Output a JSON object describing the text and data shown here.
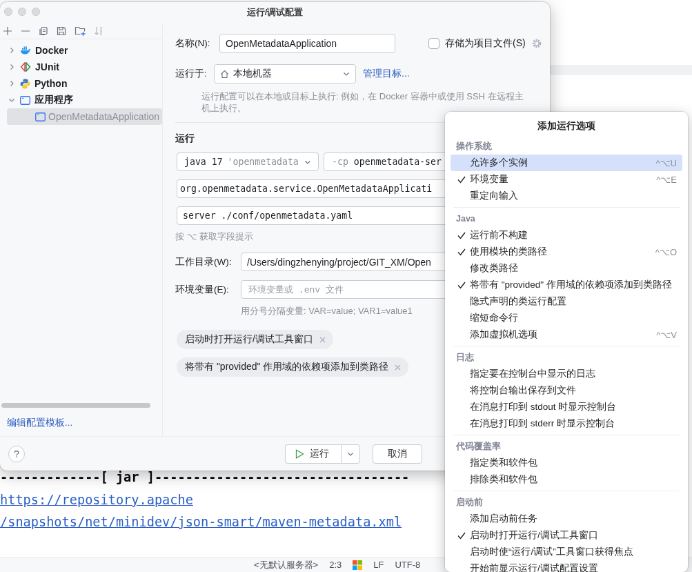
{
  "ide": {
    "console_lines": [
      {
        "kind": "rule",
        "text": "-------------[ jar ]---------------------------------"
      },
      {
        "kind": "link",
        "text": "https://repository.apache"
      },
      {
        "kind": "link",
        "text": "/snapshots/net/minidev/json-smart/maven-metadata.xml"
      }
    ],
    "status_bar": {
      "server": "<无默认服务器>",
      "position": "2:3",
      "line_separator": "LF",
      "encoding": "UTF-8"
    }
  },
  "dialog": {
    "title": "运行/调试配置",
    "tree": [
      {
        "label": "Docker",
        "kind": "docker",
        "expanded": false,
        "selected": false
      },
      {
        "label": "JUnit",
        "kind": "junit",
        "expanded": false,
        "selected": false
      },
      {
        "label": "Python",
        "kind": "python",
        "expanded": false,
        "selected": false
      },
      {
        "label": "应用程序",
        "kind": "application",
        "expanded": true,
        "selected": false,
        "children": [
          {
            "label": "OpenMetadataApplication",
            "kind": "application",
            "selected": true
          }
        ]
      }
    ],
    "edit_templates_link": "编辑配置模板...",
    "form": {
      "name_label": "名称(N):",
      "name_value": "OpenMetadataApplication",
      "store_checkbox": {
        "label": "存储为项目文件(S)",
        "checked": false
      },
      "run_on_label": "运行于:",
      "run_on_value": "本地机器",
      "manage_link": "管理目标...",
      "run_on_hint": "运行配置可以在本地或目标上执行: 例如，在 Docker 容器中或使用 SSH 在远程主机上执行。",
      "section_title": "运行",
      "jdk_version": "java 17",
      "jdk_name": "'openmetadata",
      "cp_flag": "-cp",
      "cp_value": "openmetadata-ser",
      "main_class": "org.openmetadata.service.OpenMetadataApplicati",
      "program_args": "server ./conf/openmetadata.yaml",
      "field_hint": "按 ⌥ 获取字段提示",
      "workdir_label": "工作目录(W):",
      "workdir_value": "/Users/dingzhenying/project/GIT_XM/Open",
      "env_label": "环境变量(E):",
      "env_placeholder": "环境变量或 .env 文件",
      "env_hint": "用分号分隔变量: VAR=value; VAR1=value1",
      "option_tags": [
        "启动时打开运行/调试工具窗口",
        "将带有 \"provided\" 作用域的依赖项添加到类路径"
      ]
    },
    "buttons": {
      "help": "?",
      "run": "运行",
      "cancel": "取消"
    }
  },
  "popup": {
    "title": "添加运行选项",
    "groups": [
      {
        "title": "操作系统",
        "items": [
          {
            "label": "允许多个实例",
            "checked": false,
            "selected": true,
            "shortcut": "^⌥U"
          },
          {
            "label": "环境变量",
            "checked": true,
            "selected": false,
            "shortcut": "^⌥E"
          },
          {
            "label": "重定向输入",
            "checked": false,
            "selected": false
          }
        ]
      },
      {
        "title": "Java",
        "items": [
          {
            "label": "运行前不构建",
            "checked": true,
            "selected": false
          },
          {
            "label": "使用模块的类路径",
            "checked": true,
            "selected": false,
            "shortcut": "^⌥O"
          },
          {
            "label": "修改类路径",
            "checked": false,
            "selected": false
          },
          {
            "label": "将带有 \"provided\" 作用域的依赖项添加到类路径",
            "checked": true,
            "selected": false
          },
          {
            "label": "隐式声明的类运行配置",
            "checked": false,
            "selected": false
          },
          {
            "label": "缩短命令行",
            "checked": false,
            "selected": false
          },
          {
            "label": "添加虚拟机选项",
            "checked": false,
            "selected": false,
            "shortcut": "^⌥V"
          }
        ]
      },
      {
        "title": "日志",
        "items": [
          {
            "label": "指定要在控制台中显示的日志",
            "checked": false,
            "selected": false
          },
          {
            "label": "将控制台输出保存到文件",
            "checked": false,
            "selected": false
          },
          {
            "label": "在消息打印到 stdout 时显示控制台",
            "checked": false,
            "selected": false
          },
          {
            "label": "在消息打印到 stderr 时显示控制台",
            "checked": false,
            "selected": false
          }
        ]
      },
      {
        "title": "代码覆盖率",
        "items": [
          {
            "label": "指定类和软件包",
            "checked": false,
            "selected": false
          },
          {
            "label": "排除类和软件包",
            "checked": false,
            "selected": false
          }
        ]
      },
      {
        "title": "启动前",
        "items": [
          {
            "label": "添加启动前任务",
            "checked": false,
            "selected": false
          },
          {
            "label": "启动时打开运行/调试工具窗口",
            "checked": true,
            "selected": false
          },
          {
            "label": "启动时使“运行/调试”工具窗口获得焦点",
            "checked": false,
            "selected": false
          },
          {
            "label": "开始前显示运行/调试配置设置",
            "checked": false,
            "selected": false
          }
        ]
      }
    ]
  }
}
